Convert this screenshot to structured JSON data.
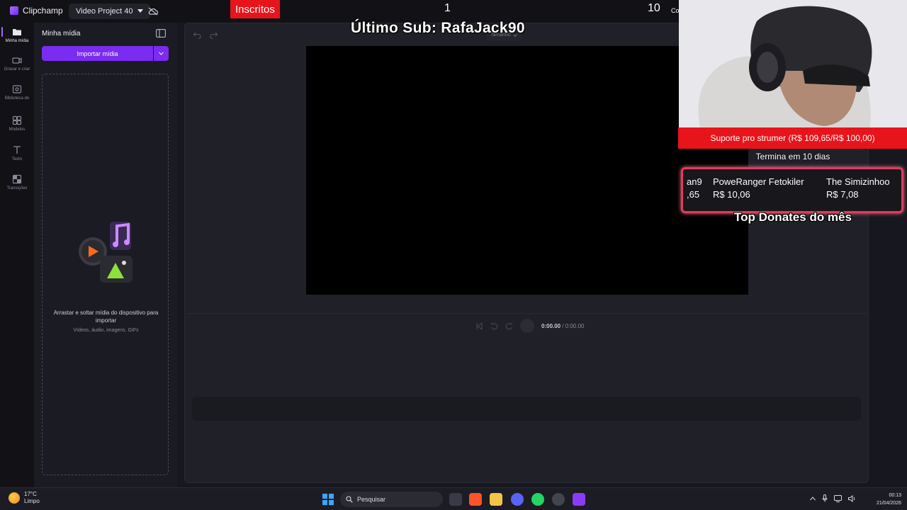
{
  "app": {
    "name": "Clipchamp",
    "project_name": "Video Project 40"
  },
  "stream_overlay": {
    "subs_label": "Inscritos",
    "count_left": "1",
    "count_right": "10",
    "count_right_suffix": "Co",
    "last_sub": "Último Sub: RafaJack90",
    "goal_text": "Suporte pro strumer (R$ 109,65/R$ 100,00)",
    "goal_ends": "Termina em 10 dias",
    "top_donors": [
      {
        "name": "an9",
        "amount": ",65"
      },
      {
        "name": "PoweRanger Fetokiler",
        "amount": "R$ 10,06"
      },
      {
        "name": "The Simizinhoo",
        "amount": "R$ 7,08"
      }
    ],
    "top_donates_title": "Top Donates do mês"
  },
  "rail": {
    "items": [
      {
        "label": "Minha mídia",
        "icon": "folder-icon"
      },
      {
        "label": "Gravar e criar",
        "icon": "camera-icon"
      },
      {
        "label": "Biblioteca de",
        "icon": "library-icon"
      },
      {
        "label": "Modelos",
        "icon": "templates-icon"
      },
      {
        "label": "Texto",
        "icon": "text-icon"
      },
      {
        "label": "Transições",
        "icon": "transitions-icon"
      }
    ]
  },
  "media_panel": {
    "title": "Minha mídia",
    "import_label": "Importar mídia",
    "drop_text": "Arrastar e soltar mídia do dispositivo para importar",
    "drop_sub": "Vídeos, áudio, imagens, GIFs"
  },
  "editor": {
    "size_label": "Tamanho",
    "time_current": "0:00.00",
    "time_total": " / 0:00.00"
  },
  "taskbar": {
    "temperature": "17°C",
    "condition": "Limpo",
    "search_placeholder": "Pesquisar",
    "time": "00:13",
    "date": "21/04/2026"
  },
  "colors": {
    "accent": "#7a2cf0",
    "overlay_red": "#e8141b",
    "donor_border": "#e23b5a"
  }
}
